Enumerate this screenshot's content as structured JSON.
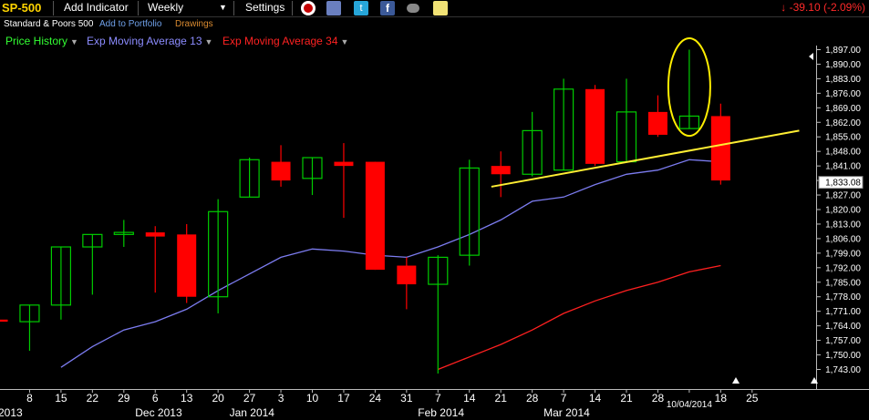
{
  "toolbar": {
    "symbol": "SP-500",
    "add_indicator": "Add Indicator",
    "period": "Weekly",
    "settings": "Settings",
    "change": "-39.10 (-2.09%)",
    "change_arrow": "↓",
    "icons": [
      "alarm-clock-icon",
      "book-icon",
      "twitter-icon",
      "facebook-icon",
      "binoculars-icon",
      "notepad-icon"
    ]
  },
  "subbar": {
    "name": "Standard & Poors 500",
    "add_portfolio": "Add to Portfolio",
    "drawings": "Drawings"
  },
  "legend": [
    {
      "label": "Price History",
      "color": "#33ff33"
    },
    {
      "label": "Exp Moving Average 13",
      "color": "#8c8cff"
    },
    {
      "label": "Exp Moving Average 34",
      "color": "#ff2222"
    }
  ],
  "colors": {
    "up": "#00cc00",
    "down": "#ff0000",
    "ema13": "#7c7cf0",
    "ema34": "#ff2020",
    "trendline": "#ffee33",
    "annotation": "#ffee00",
    "background": "#000000"
  },
  "chart_data": {
    "type": "candlestick",
    "ylim": [
      1739,
      1900
    ],
    "y_ticks": [
      "1,897.00",
      "1,890.00",
      "1,883.00",
      "1,876.00",
      "1,869.00",
      "1,862.00",
      "1,855.00",
      "1,848.00",
      "1,841.00",
      "1,834.00",
      "1,827.00",
      "1,820.00",
      "1,813.00",
      "1,806.00",
      "1,799.00",
      "1,792.00",
      "1,785.00",
      "1,778.00",
      "1,771.00",
      "1,764.00",
      "1,757.00",
      "1,750.00",
      "1,743.00"
    ],
    "current_price_label": "1,833.08",
    "current_price": 1833.08,
    "x_ticks": [
      "8",
      "15",
      "22",
      "29",
      "6",
      "13",
      "20",
      "27",
      "3",
      "10",
      "17",
      "24",
      "31",
      "7",
      "14",
      "21",
      "28",
      "7",
      "14",
      "21",
      "28",
      "10/04/2014",
      "18",
      "25"
    ],
    "month_labels": [
      "2013",
      "Dec 2013",
      "Jan 2014",
      "Feb 2014",
      "Mar 2014"
    ],
    "candles": [
      {
        "open": 1767,
        "high": 1768,
        "low": 1765,
        "close": 1766
      },
      {
        "open": 1766,
        "high": 1774,
        "low": 1752,
        "close": 1774
      },
      {
        "open": 1774,
        "high": 1802,
        "low": 1767,
        "close": 1802
      },
      {
        "open": 1802,
        "high": 1808,
        "low": 1779,
        "close": 1808
      },
      {
        "open": 1808,
        "high": 1815,
        "low": 1802,
        "close": 1809
      },
      {
        "open": 1809,
        "high": 1812,
        "low": 1780,
        "close": 1807
      },
      {
        "open": 1808,
        "high": 1813,
        "low": 1775,
        "close": 1778
      },
      {
        "open": 1778,
        "high": 1825,
        "low": 1770,
        "close": 1819
      },
      {
        "open": 1826,
        "high": 1845,
        "low": 1826,
        "close": 1844
      },
      {
        "open": 1843,
        "high": 1851,
        "low": 1831,
        "close": 1834
      },
      {
        "open": 1835,
        "high": 1845,
        "low": 1827,
        "close": 1845
      },
      {
        "open": 1843,
        "high": 1852,
        "low": 1816,
        "close": 1841
      },
      {
        "open": 1843,
        "high": 1843,
        "low": 1791,
        "close": 1791
      },
      {
        "open": 1793,
        "high": 1797,
        "low": 1772,
        "close": 1784
      },
      {
        "open": 1784,
        "high": 1798,
        "low": 1741,
        "close": 1797
      },
      {
        "open": 1798,
        "high": 1844,
        "low": 1793,
        "close": 1840
      },
      {
        "open": 1841,
        "high": 1848,
        "low": 1826,
        "close": 1837
      },
      {
        "open": 1837,
        "high": 1867,
        "low": 1836,
        "close": 1858
      },
      {
        "open": 1839,
        "high": 1883,
        "low": 1839,
        "close": 1878
      },
      {
        "open": 1878,
        "high": 1880,
        "low": 1841,
        "close": 1842
      },
      {
        "open": 1843,
        "high": 1883,
        "low": 1843,
        "close": 1867
      },
      {
        "open": 1867,
        "high": 1875,
        "low": 1855,
        "close": 1856
      },
      {
        "open": 1859,
        "high": 1897,
        "low": 1859,
        "close": 1865
      },
      {
        "open": 1865,
        "high": 1871,
        "low": 1832,
        "close": 1834
      }
    ],
    "ema13": [
      null,
      null,
      1744,
      1754,
      1762,
      1766,
      1772,
      1781,
      1789,
      1797,
      1801,
      1800,
      1798,
      1797,
      1802,
      1808,
      1815,
      1824,
      1826,
      1832,
      1837,
      1839,
      1844,
      1843
    ],
    "ema34": [
      null,
      null,
      null,
      null,
      null,
      null,
      null,
      null,
      null,
      null,
      null,
      null,
      null,
      null,
      1743,
      1749,
      1755,
      1762,
      1770,
      1776,
      1781,
      1785,
      1790,
      1793
    ],
    "trendline": {
      "start": [
        15.7,
        1831
      ],
      "end": [
        25.5,
        1858
      ]
    },
    "annotation": "ellipse around the 10/04/2014 week candle"
  }
}
